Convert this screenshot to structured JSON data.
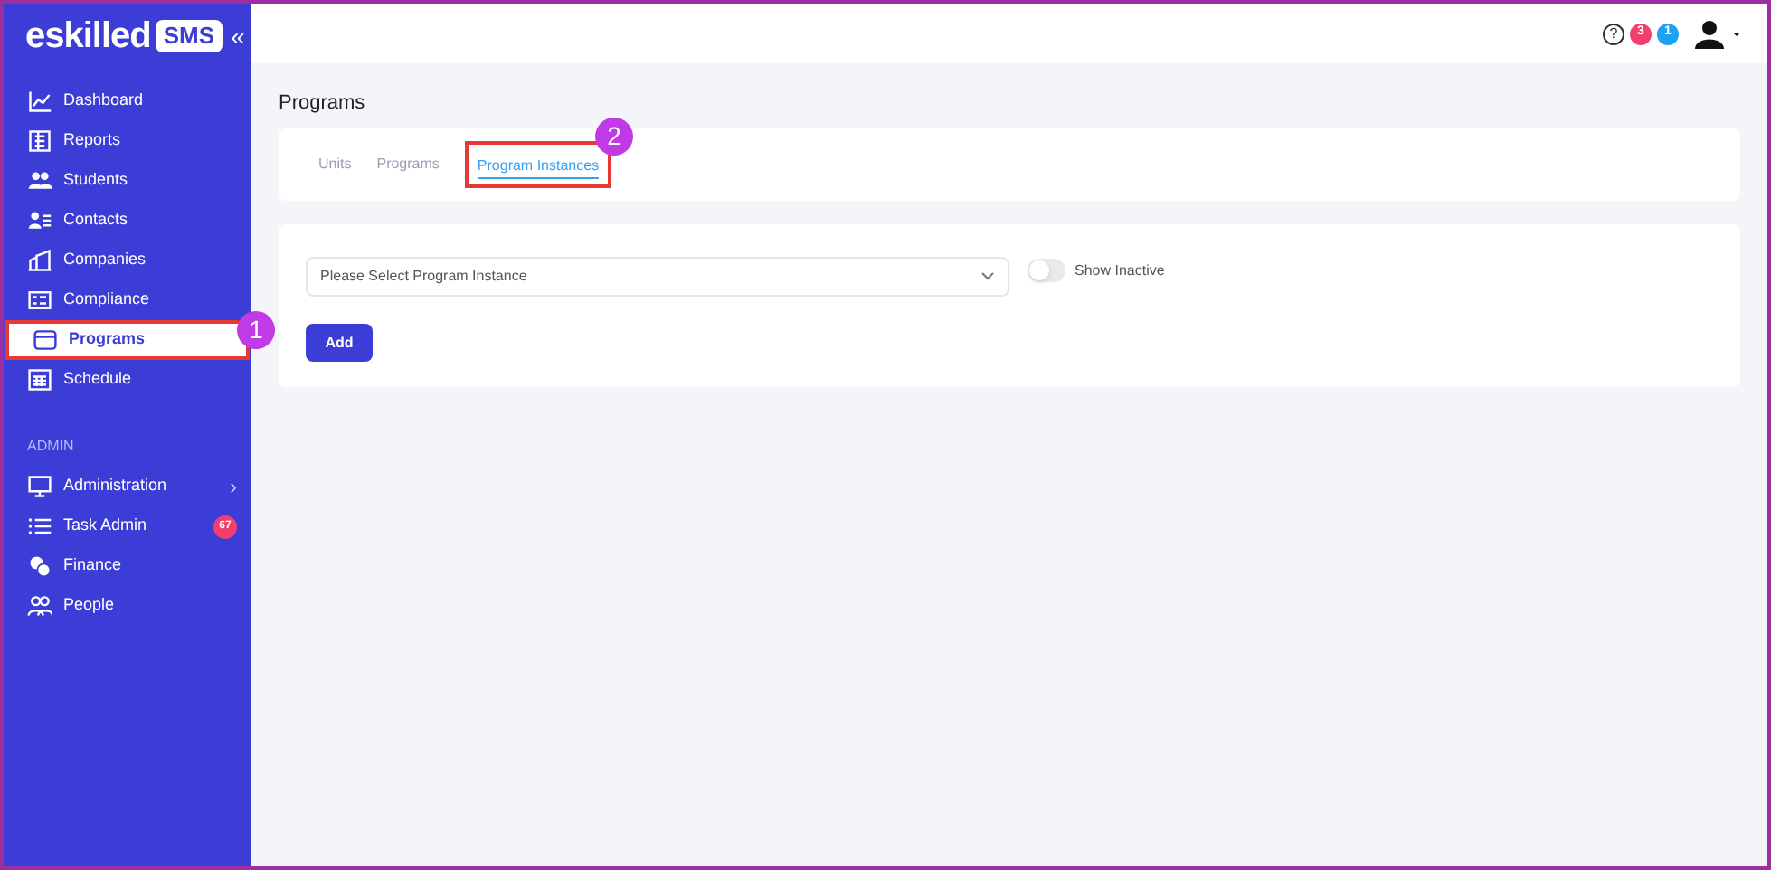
{
  "logo": {
    "brand": "eskilled",
    "badge": "SMS",
    "collapse": "«"
  },
  "sidebar": {
    "items": [
      {
        "label": "Dashboard",
        "kind": "chart",
        "selected": false
      },
      {
        "label": "Reports",
        "kind": "report",
        "selected": false
      },
      {
        "label": "Students",
        "kind": "people",
        "selected": false
      },
      {
        "label": "Contacts",
        "kind": "contact",
        "selected": false
      },
      {
        "label": "Companies",
        "kind": "building",
        "selected": false
      },
      {
        "label": "Compliance",
        "kind": "card",
        "selected": false
      },
      {
        "label": "Programs",
        "kind": "window",
        "selected": true,
        "callout": "1"
      },
      {
        "label": "Schedule",
        "kind": "calendar",
        "selected": false
      }
    ],
    "section": "ADMIN",
    "admin_items": [
      {
        "label": "Administration",
        "kind": "monitor",
        "chevron": "›"
      },
      {
        "label": "Task Admin",
        "kind": "list",
        "badge": "67"
      },
      {
        "label": "Finance",
        "kind": "coins"
      },
      {
        "label": "People",
        "kind": "outline-people"
      }
    ]
  },
  "topbar": {
    "help": "?",
    "badges": [
      {
        "text": "3",
        "color": "#f43f6e"
      },
      {
        "text": "1",
        "color": "#1da1f2"
      }
    ]
  },
  "page_title": "Programs",
  "tabs": [
    {
      "label": "Units",
      "selected": false
    },
    {
      "label": "Programs",
      "selected": false
    },
    {
      "label": "Program Instances",
      "selected": true,
      "callout": "2"
    }
  ],
  "select": {
    "placeholder": "Please Select Program Instance"
  },
  "toggle": {
    "label": "Show Inactive",
    "on": false
  },
  "add_button": "Add"
}
